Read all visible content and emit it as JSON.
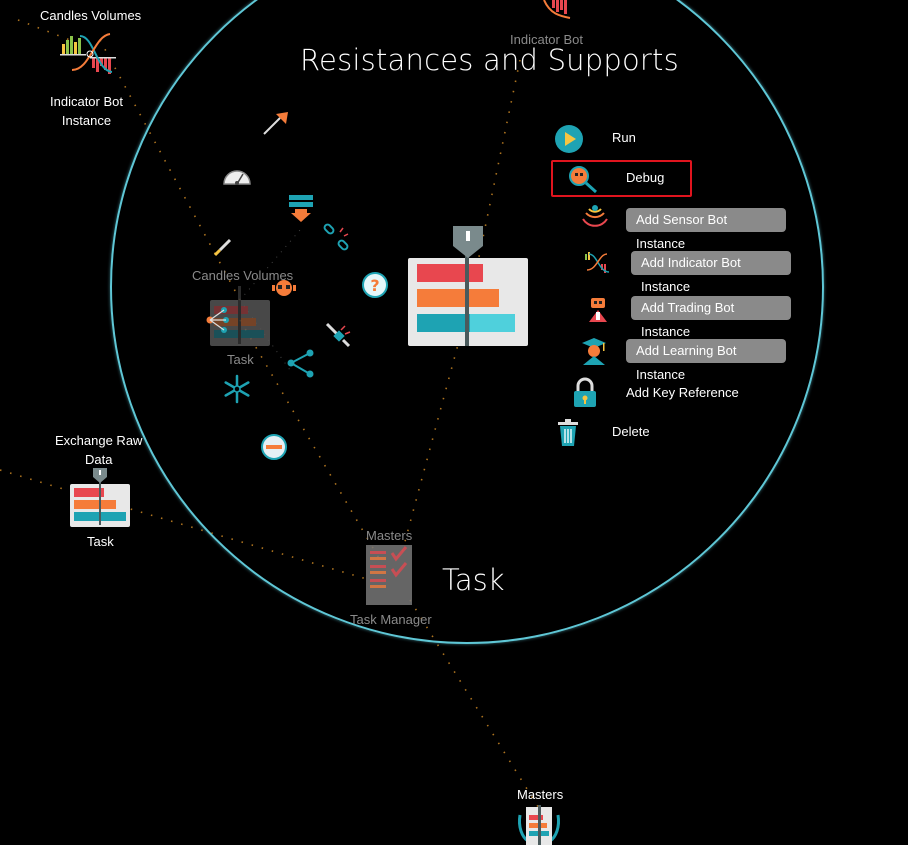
{
  "canvas": {
    "circle_title": "Resistances and Supports",
    "node_title": "Task"
  },
  "menu": {
    "run_label": "Run",
    "debug_label": "Debug",
    "add_sensor_label": "Add Sensor Bot Instance",
    "add_indicator_label": "Add Indicator Bot Instance",
    "add_trading_label": "Add Trading Bot Instance",
    "add_learning_label": "Add Learning Bot Instance",
    "add_key_label": "Add Key Reference",
    "delete_label": "Delete"
  },
  "nodes": {
    "candles_volumes_top": "Candles Volumes",
    "indicator_bot_instance": "Indicator Bot\nInstance",
    "indicator_bot_top": "Indicator Bot",
    "candles_volumes_inner": "Candles Volumes",
    "task_inner": "Task",
    "exchange_raw_data": "Exchange Raw\nData",
    "task_left": "Task",
    "masters_inner": "Masters",
    "task_manager": "Task Manager",
    "masters_bottom": "Masters"
  },
  "colors": {
    "ring": "#5fc7d6",
    "highlight": "#e0141e",
    "bar_red": "#e8474f",
    "bar_orange": "#f57c3a",
    "bar_teal": "#1ea3b3",
    "dotted_link": "#e89b2a"
  }
}
